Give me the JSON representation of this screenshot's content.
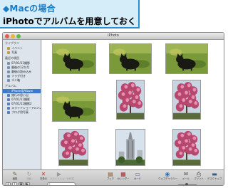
{
  "caption": {
    "title": "◆Macの場合",
    "subtitle": "iPhotoでアルバムを用意しておく"
  },
  "window": {
    "title": "iPhoto"
  },
  "sidebar": {
    "sections": [
      {
        "heading": "ライブラリ",
        "items": [
          {
            "label": "イベント",
            "icon": "library-icon",
            "selected": false
          },
          {
            "label": "写真",
            "icon": "library-icon",
            "selected": false
          }
        ]
      },
      {
        "heading": "最近の項目",
        "items": [
          {
            "label": "07/01/11撮影",
            "icon": "event-icon",
            "selected": false
          },
          {
            "label": "最後の12か月",
            "icon": "event-icon",
            "selected": false
          },
          {
            "label": "最後の読み込み",
            "icon": "event-icon",
            "selected": false
          },
          {
            "label": "フラグ付き",
            "icon": "event-icon",
            "selected": false
          },
          {
            "label": "ゴミ箱",
            "icon": "event-icon",
            "selected": false
          }
        ]
      },
      {
        "heading": "アルバム",
        "items": [
          {
            "label": "iPhone用Album",
            "icon": "album-icon",
            "selected": true
          },
          {
            "label": "旅行の思い出",
            "icon": "album-icon",
            "selected": false
          },
          {
            "label": "07/01/11撮影",
            "icon": "album-icon",
            "selected": false
          },
          {
            "label": "07/01/11撮影2",
            "icon": "album-icon",
            "selected": false
          },
          {
            "label": "スライドショーアルバム",
            "icon": "album-icon",
            "selected": false
          },
          {
            "label": "ブログ用写真",
            "icon": "album-icon",
            "selected": false
          }
        ]
      }
    ]
  },
  "photos": [
    {
      "subject": "black-cat-on-grass"
    },
    {
      "subject": "black-cat-on-grass"
    },
    {
      "subject": "black-cat-on-grass"
    },
    {
      "subject": "pink-blossom-tree"
    },
    {
      "subject": "pink-blossom-tree"
    },
    {
      "subject": "black-cat-on-grass"
    },
    {
      "subject": "pink-blossom-tree"
    },
    {
      "subject": "tower-building"
    },
    {
      "subject": "pink-blossom-tree"
    }
  ],
  "toolbar": {
    "tools": [
      {
        "label": "編集",
        "icon": "pencil-icon",
        "enabled": true
      },
      {
        "label": "回転",
        "icon": "rotate-icon",
        "enabled": false
      },
      {
        "label": "非表示",
        "icon": "hide-icon",
        "enabled": true
      },
      {
        "label": "スライドショーを作成",
        "icon": "slideshow-icon",
        "enabled": false
      },
      {
        "label": "ブック",
        "icon": "book-icon",
        "enabled": true
      },
      {
        "label": "カレンダー",
        "icon": "calendar-icon",
        "enabled": true
      },
      {
        "label": "カード",
        "icon": "card-icon",
        "enabled": true
      },
      {
        "label": "ウェブギャラリー",
        "icon": "web-gallery-icon",
        "enabled": true
      },
      {
        "label": "メール",
        "icon": "mail-icon",
        "enabled": true
      },
      {
        "label": "プリント",
        "icon": "print-icon",
        "enabled": true
      },
      {
        "label": "デスクトップ",
        "icon": "desktop-icon",
        "enabled": true
      }
    ],
    "search_placeholder": ""
  },
  "colors": {
    "caption_border": "#2a90d2",
    "caption_fill": "#d5ecf9",
    "selection": "#3c7ad0"
  }
}
